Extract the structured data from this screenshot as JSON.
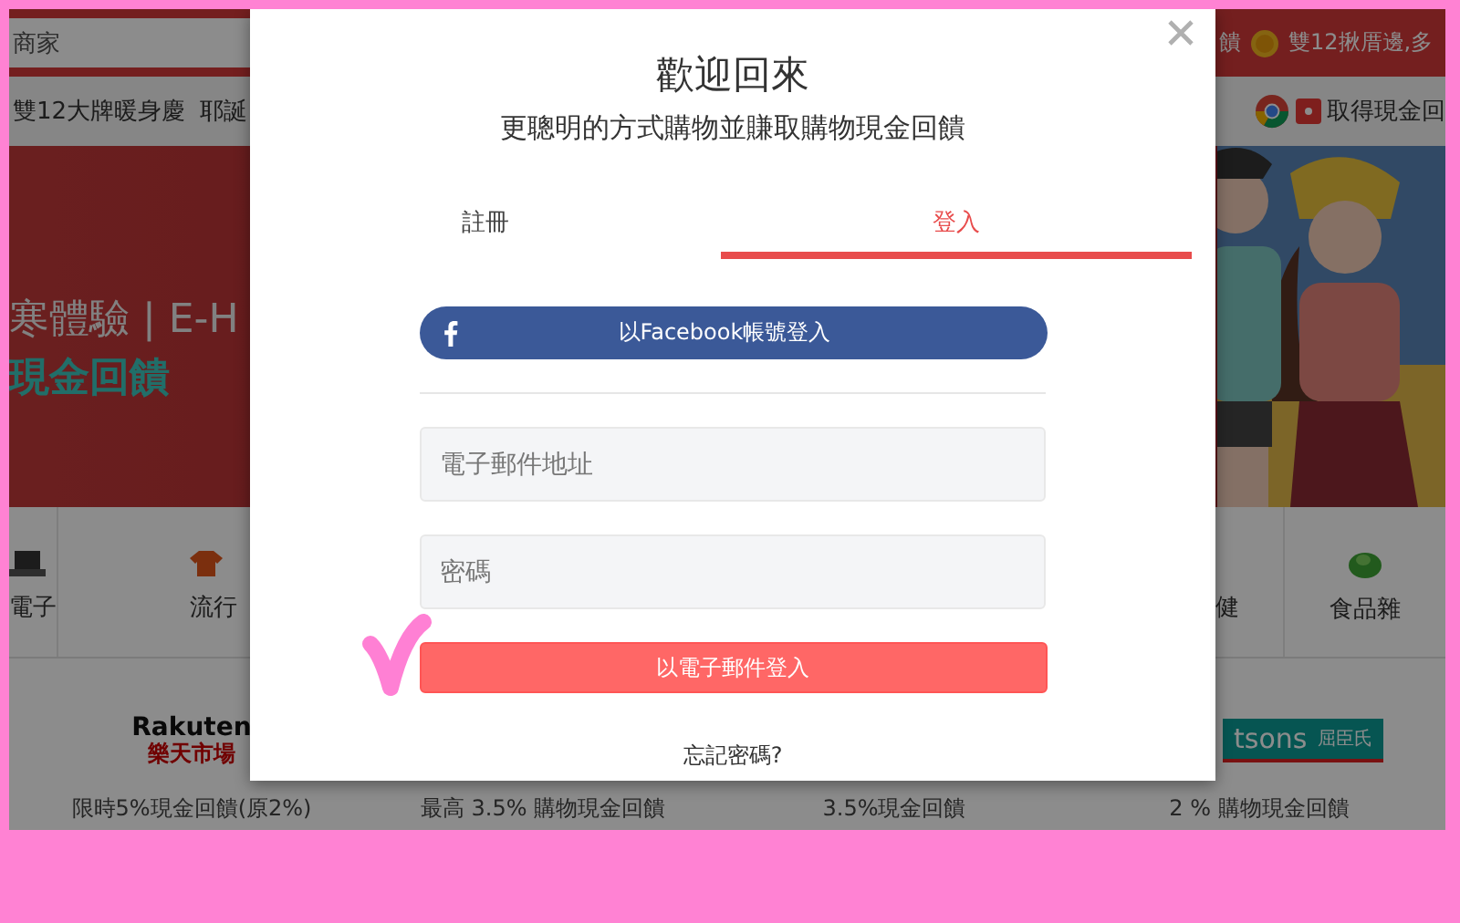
{
  "site": {
    "search": {
      "value": "商家"
    },
    "top_links": [
      "饋",
      "雙12揪厝邊,多"
    ],
    "nav_items": [
      "雙12大牌暖身慶",
      "耶誕"
    ],
    "extension_link": "取得現金回",
    "banner": {
      "lines": [
        "寒體驗 | E-H",
        "現金回饋"
      ]
    },
    "categories": [
      {
        "label": "電子",
        "kind": "laptop"
      },
      {
        "label": "流行",
        "kind": "shirt"
      },
      {
        "label": "健",
        "kind": "none"
      },
      {
        "label": "食品雜",
        "kind": "veg"
      }
    ],
    "stores": [
      {
        "kind": "rakuten",
        "logo_text": [
          "Rakuten",
          "樂天市場"
        ],
        "offer": "限時5%現金回饋(原2%)"
      },
      {
        "offer": "最高 3.5% 購物現金回饋"
      },
      {
        "offer": "3.5%現金回饋"
      },
      {
        "kind": "watsons",
        "logo_text": [
          "tsons",
          "屈臣氏"
        ],
        "offer": "2 % 購物現金回饋"
      }
    ]
  },
  "modal": {
    "title": "歡迎回來",
    "subtitle": "更聰明的方式購物並賺取購物現金回饋",
    "tabs": [
      {
        "label": "註冊",
        "selected": false
      },
      {
        "label": "登入",
        "selected": true
      }
    ],
    "facebook_button": "以Facebook帳號登入",
    "email": {
      "placeholder": "電子郵件地址"
    },
    "password": {
      "placeholder": "密碼"
    },
    "submit": "以電子郵件登入",
    "forgot": "忘記密碼?"
  }
}
